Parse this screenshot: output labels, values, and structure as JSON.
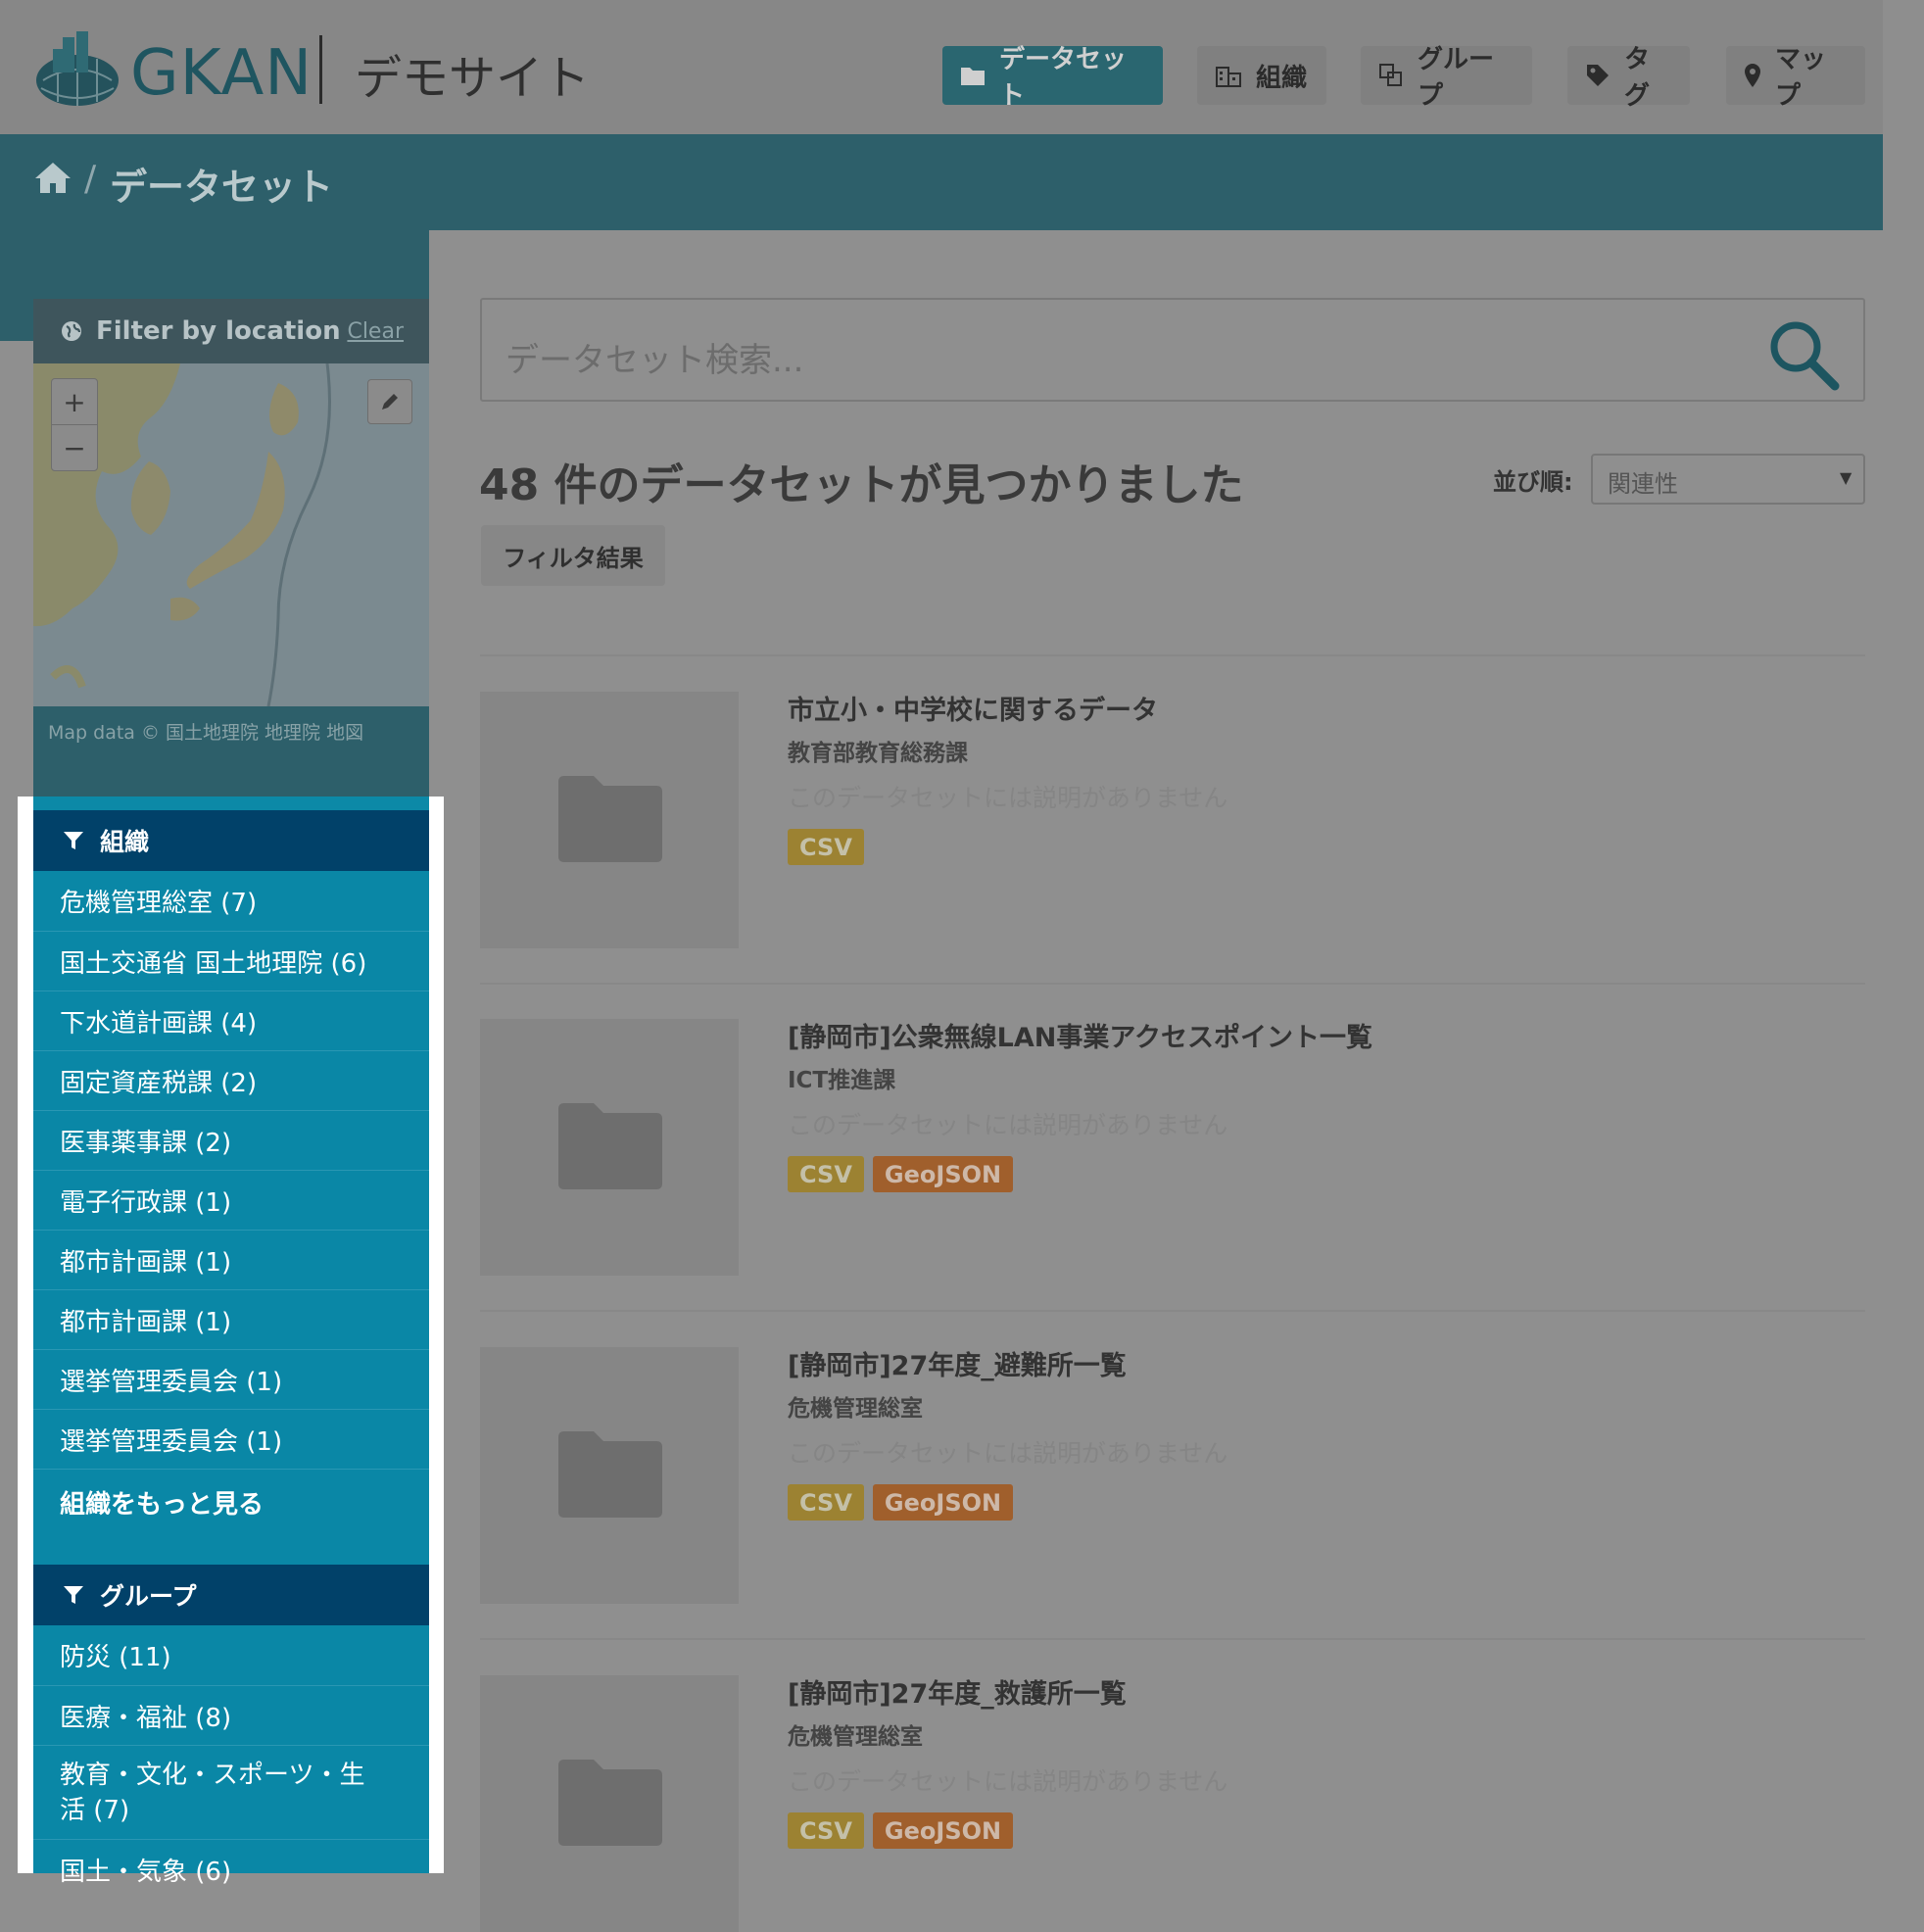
{
  "header": {
    "logo_text": "GKAN",
    "site_name": "デモサイト",
    "nav": [
      {
        "label": "データセット",
        "icon": "folder-icon",
        "active": true
      },
      {
        "label": "組織",
        "icon": "building-icon",
        "active": false
      },
      {
        "label": "グループ",
        "icon": "group-icon",
        "active": false
      },
      {
        "label": "タグ",
        "icon": "tag-icon",
        "active": false
      },
      {
        "label": "マップ",
        "icon": "map-marker-icon",
        "active": false
      }
    ]
  },
  "breadcrumb": {
    "separator": "/",
    "current": "データセット"
  },
  "location_filter": {
    "title": "Filter by location",
    "clear_label": "Clear",
    "zoom_in": "+",
    "zoom_out": "−",
    "attribution": "Map data © 国土地理院 地理院 地図"
  },
  "search": {
    "placeholder": "データセット検索..."
  },
  "results": {
    "count_text": "48 件のデータセットが見つかりました",
    "sort_label": "並び順:",
    "sort_value": "関連性",
    "filter_pill": "フィルタ結果"
  },
  "datasets": [
    {
      "title": "市立小・中学校に関するデータ",
      "org": "教育部教育総務課",
      "desc": "このデータセットには説明がありません",
      "formats": [
        "CSV"
      ]
    },
    {
      "title": "[静岡市]公衆無線LAN事業アクセスポイント一覧",
      "org": "ICT推進課",
      "desc": "このデータセットには説明がありません",
      "formats": [
        "CSV",
        "GeoJSON"
      ]
    },
    {
      "title": "[静岡市]27年度_避難所一覧",
      "org": "危機管理総室",
      "desc": "このデータセットには説明がありません",
      "formats": [
        "CSV",
        "GeoJSON"
      ]
    },
    {
      "title": "[静岡市]27年度_救護所一覧",
      "org": "危機管理総室",
      "desc": "このデータセットには説明がありません",
      "formats": [
        "CSV",
        "GeoJSON"
      ]
    }
  ],
  "facets": {
    "organizations": {
      "title": "組織",
      "items": [
        "危機管理総室 (7)",
        "国土交通省 国土地理院 (6)",
        "下水道計画課 (4)",
        "固定資産税課 (2)",
        "医事薬事課 (2)",
        "電子行政課 (1)",
        "都市計画課 (1)",
        "都市計画課 (1)",
        "選挙管理委員会 (1)",
        "選挙管理委員会 (1)"
      ],
      "more_label": "組織をもっと見る"
    },
    "groups": {
      "title": "グループ",
      "items": [
        "防災 (11)",
        "医療・福祉 (8)",
        "教育・文化・スポーツ・生活 (7)",
        "国土・気象 (6)"
      ]
    }
  },
  "colors": {
    "facet_header": "#014169",
    "facet_body": "#0a87a6",
    "highlight_frame": "#ffffff",
    "csv_badge": "#9c8232",
    "geojson_badge": "#a05f2c",
    "active_nav": "#2a6670"
  }
}
